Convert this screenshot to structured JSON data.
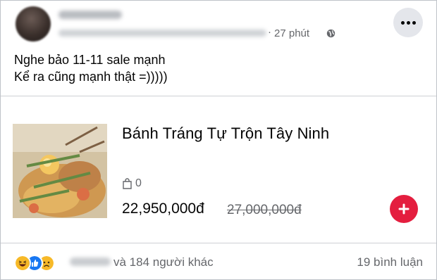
{
  "header": {
    "timestamp": "27 phút",
    "separator": "·",
    "privacy_icon": "globe-icon",
    "more_icon": "ellipsis-icon"
  },
  "caption": {
    "line1": "Nghe bảo 11-11 sale mạnh",
    "line2": "Kể ra cũng mạnh thật =)))))"
  },
  "product": {
    "title": "Bánh Tráng Tự Trộn Tây Ninh",
    "stock_icon": "shopping-bag-icon",
    "stock_count": "0",
    "price": "22,950,000đ",
    "original_price": "27,000,000đ",
    "add_icon": "plus-icon",
    "accent_color": "#e41e3f"
  },
  "footer": {
    "reaction_icons": [
      "haha-reaction-icon",
      "like-reaction-icon",
      "sad-reaction-icon"
    ],
    "reactor_text": "và 184 người khác",
    "comments": "19 bình luận"
  }
}
